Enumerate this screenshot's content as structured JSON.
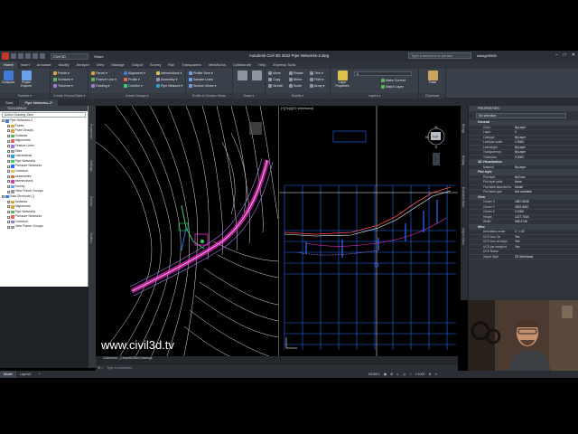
{
  "app": {
    "title": "Autodesk Civil 3D 2022   Pipe Networks-2.dwg",
    "file_dropdown": "Civil 3D",
    "share": "Share",
    "search_placeholder": "Type a keyword or phrase",
    "user": "kaleigh9508"
  },
  "menu": [
    "Home",
    "Insert",
    "Annotate",
    "Modify",
    "Analyze",
    "View",
    "Manage",
    "Output",
    "Survey",
    "Rail",
    "Transparent",
    "InfraWorks",
    "Collaborate",
    "Help",
    "Express Tools"
  ],
  "ribbon": {
    "groups": [
      "Palettes ▾",
      "Create Ground Data ▾",
      "Create Design ▾",
      "Profile & Section Views",
      "Draw ▾",
      "Modify ▾",
      "Layers ▾",
      "Clipboard"
    ],
    "palettes": {
      "toolspace": "Toolspace",
      "prospector": "Project Explorer"
    },
    "ground": {
      "points": "Points ▾",
      "surfaces": "Surfaces ▾",
      "traverse": "Traverse ▾"
    },
    "design": [
      "Parcel ▾",
      "Feature Line ▾",
      "Grading ▾",
      "Alignment ▾",
      "Profile ▾",
      "Corridor ▾",
      "Intersections ▾",
      "Assembly ▾",
      "Pipe Network ▾"
    ],
    "views": [
      "Profile View ▾",
      "Sample Lines",
      "Section Views ▾"
    ],
    "modify": [
      "Move",
      "Copy",
      "Stretch",
      "Rotate",
      "Mirror",
      "Scale",
      "Trim ▾",
      "Fillet ▾",
      "Array ▾"
    ],
    "layers": {
      "properties": "Layer Properties",
      "current": "0",
      "make_current": "Make Current",
      "match": "Match Layer"
    },
    "clipboard": "Paste"
  },
  "doc_tabs": [
    "Start",
    "Pipe Networks-2*"
  ],
  "toolspace": {
    "header": "TOOLSPACE",
    "dropdown": "Active Drawing View",
    "tree": [
      {
        "label": "Pipe Networks-2",
        "indent": 0
      },
      {
        "label": "Points",
        "indent": 1
      },
      {
        "label": "Point Groups",
        "indent": 1
      },
      {
        "label": "Surfaces",
        "indent": 1
      },
      {
        "label": "Alignments",
        "indent": 1
      },
      {
        "label": "Feature Lines",
        "indent": 1
      },
      {
        "label": "Sites",
        "indent": 1
      },
      {
        "label": "Catchments",
        "indent": 1
      },
      {
        "label": "Pipe Networks",
        "indent": 1
      },
      {
        "label": "Pressure Networks",
        "indent": 1
      },
      {
        "label": "Corridors",
        "indent": 1
      },
      {
        "label": "Assemblies",
        "indent": 1
      },
      {
        "label": "Intersections",
        "indent": 1
      },
      {
        "label": "Survey",
        "indent": 1
      },
      {
        "label": "View Frame Groups",
        "indent": 1
      },
      {
        "label": "Data Shortcuts [ ]",
        "indent": 0
      },
      {
        "label": "Surfaces",
        "indent": 1
      },
      {
        "label": "Alignments",
        "indent": 1
      },
      {
        "label": "Pipe Networks",
        "indent": 1
      },
      {
        "label": "Pressure Networks",
        "indent": 1
      },
      {
        "label": "Corridors",
        "indent": 1
      },
      {
        "label": "View Frame Groups",
        "indent": 1
      }
    ],
    "side_tabs": [
      "Prospector",
      "Settings",
      "Survey",
      "Toolbox"
    ]
  },
  "viewport_right": {
    "label": "[+][Top][2D Wireframe]"
  },
  "command": {
    "history": "Command: _CloseAllOtherDrawings",
    "prompt": "Type a command"
  },
  "status": {
    "model": "Model",
    "layout": "Layout1",
    "coords": "MODEL",
    "scale": "1:1000"
  },
  "properties": {
    "header": "PROPERTIES",
    "selection": "No selection",
    "sections": [
      {
        "title": "General",
        "rows": [
          [
            "Color",
            "ByLayer"
          ],
          [
            "Layer",
            "0"
          ],
          [
            "Linetype",
            "ByLayer"
          ],
          [
            "Linetype scale",
            "1.0000"
          ],
          [
            "Lineweight",
            "ByLayer"
          ],
          [
            "Transparency",
            "ByLayer"
          ],
          [
            "Thickness",
            "0.0000"
          ]
        ]
      },
      {
        "title": "3D Visualization",
        "rows": [
          [
            "Material",
            "ByLayer"
          ]
        ]
      },
      {
        "title": "Plot style",
        "rows": [
          [
            "Plot style",
            "ByColor"
          ],
          [
            "Plot style table",
            "None"
          ],
          [
            "Plot table attached to",
            "Model"
          ],
          [
            "Plot table type",
            "Not available"
          ]
        ]
      },
      {
        "title": "View",
        "rows": [
          [
            "Center X",
            "2867.8838"
          ],
          [
            "Center Y",
            "2602.5657"
          ],
          [
            "Center Z",
            "0.0000"
          ],
          [
            "Height",
            "1227.7004"
          ],
          [
            "Width",
            "868.4746"
          ]
        ]
      },
      {
        "title": "Misc",
        "rows": [
          [
            "Annotation scale",
            "1\" = 40'"
          ],
          [
            "UCS icon On",
            "Yes"
          ],
          [
            "UCS icon at origin",
            "Yes"
          ],
          [
            "UCS per viewport",
            "Yes"
          ],
          [
            "UCS Name",
            ""
          ],
          [
            "Visual Style",
            "2D Wireframe"
          ]
        ]
      }
    ],
    "side_tabs": [
      "Design",
      "Display",
      "Extended Data",
      "Object Class"
    ]
  },
  "watermark": "www.civil3d.tv",
  "colors": {
    "accent": "#3f7ad6",
    "magenta": "#ff2bd6",
    "green": "#35d16b",
    "blue": "#2a6fff",
    "white": "#ffffff"
  }
}
